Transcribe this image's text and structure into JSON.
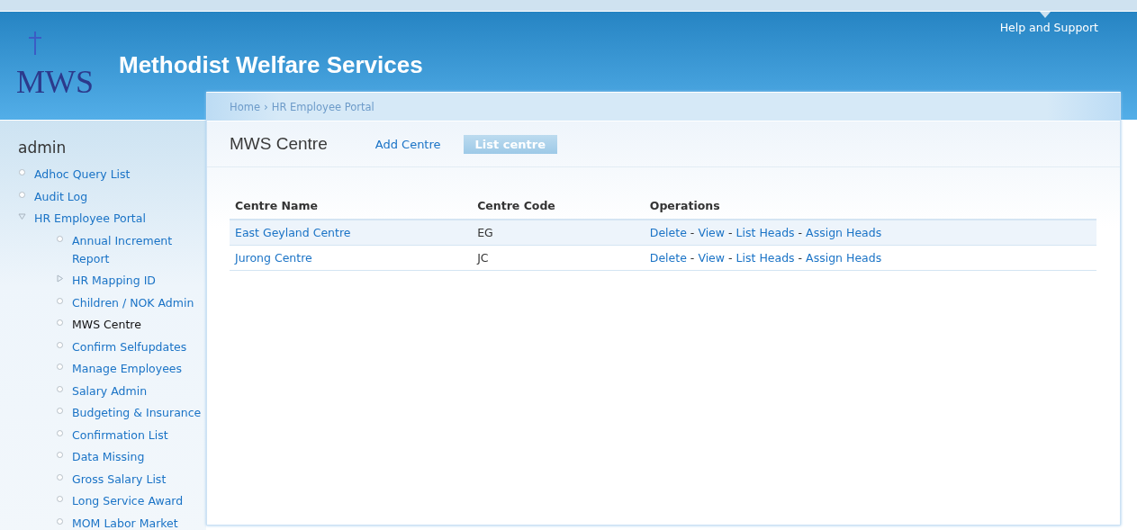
{
  "header": {
    "logo_text": "MWS",
    "site_name": "Methodist Welfare Services",
    "help_link": "Help and Support"
  },
  "breadcrumb": {
    "items": [
      "Home",
      "HR Employee Portal"
    ],
    "separator": "›"
  },
  "sidebar": {
    "title": "admin",
    "items": [
      {
        "label": "Adhoc Query List",
        "kind": "leaf",
        "selected": false
      },
      {
        "label": "Audit Log",
        "kind": "leaf",
        "selected": false
      },
      {
        "label": "HR Employee Portal",
        "kind": "branch",
        "expanded": true,
        "selected": false,
        "children": [
          {
            "label": "Annual Increment Report",
            "kind": "leaf",
            "selected": false
          },
          {
            "label": "HR Mapping ID",
            "kind": "branch",
            "expanded": false,
            "selected": false
          },
          {
            "label": "Children / NOK Admin",
            "kind": "leaf",
            "selected": false
          },
          {
            "label": "MWS Centre",
            "kind": "leaf",
            "selected": true
          },
          {
            "label": "Confirm Selfupdates",
            "kind": "leaf",
            "selected": false
          },
          {
            "label": "Manage Employees",
            "kind": "leaf",
            "selected": false
          },
          {
            "label": "Salary Admin",
            "kind": "leaf",
            "selected": false
          },
          {
            "label": "Budgeting & Insurance",
            "kind": "leaf",
            "selected": false
          },
          {
            "label": "Confirmation List",
            "kind": "leaf",
            "selected": false
          },
          {
            "label": "Data Missing",
            "kind": "leaf",
            "selected": false
          },
          {
            "label": "Gross Salary List",
            "kind": "leaf",
            "selected": false
          },
          {
            "label": "Long Service Award",
            "kind": "leaf",
            "selected": false
          },
          {
            "label": "MOM Labor Market",
            "kind": "leaf",
            "selected": false
          }
        ]
      }
    ]
  },
  "page": {
    "title": "MWS Centre",
    "tabs": [
      {
        "label": "Add Centre",
        "selected": false
      },
      {
        "label": "List centre",
        "selected": true
      }
    ]
  },
  "table": {
    "columns": [
      "Centre Name",
      "Centre Code",
      "Operations"
    ],
    "separator": "-",
    "rows": [
      {
        "name": "East Geyland Centre",
        "code": "EG",
        "operations": [
          "Delete",
          "View",
          "List Heads",
          "Assign Heads"
        ]
      },
      {
        "name": "Jurong Centre",
        "code": "JC",
        "operations": [
          "Delete",
          "View",
          "List Heads",
          "Assign Heads"
        ]
      }
    ]
  }
}
